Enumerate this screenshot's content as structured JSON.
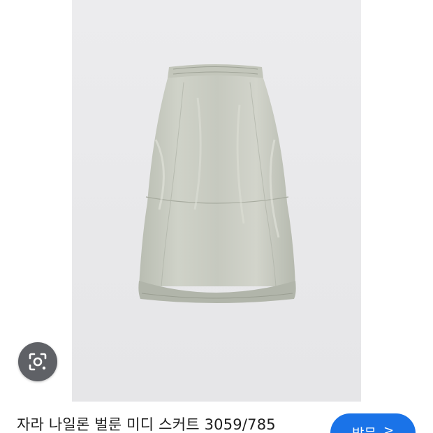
{
  "image": {
    "alt": "",
    "icon": "skirt-product-photo"
  },
  "lens": {
    "icon": "lens-camera-icon"
  },
  "result": {
    "caption": "자라 나일론 벌룬 미디 스커트 3059/785",
    "visit_label": "방문",
    "visit_icon": "chevron-right-icon"
  },
  "colors": {
    "accent": "#1a73e8",
    "lens_bg": "#5f6166",
    "image_bg": "#ececee"
  }
}
